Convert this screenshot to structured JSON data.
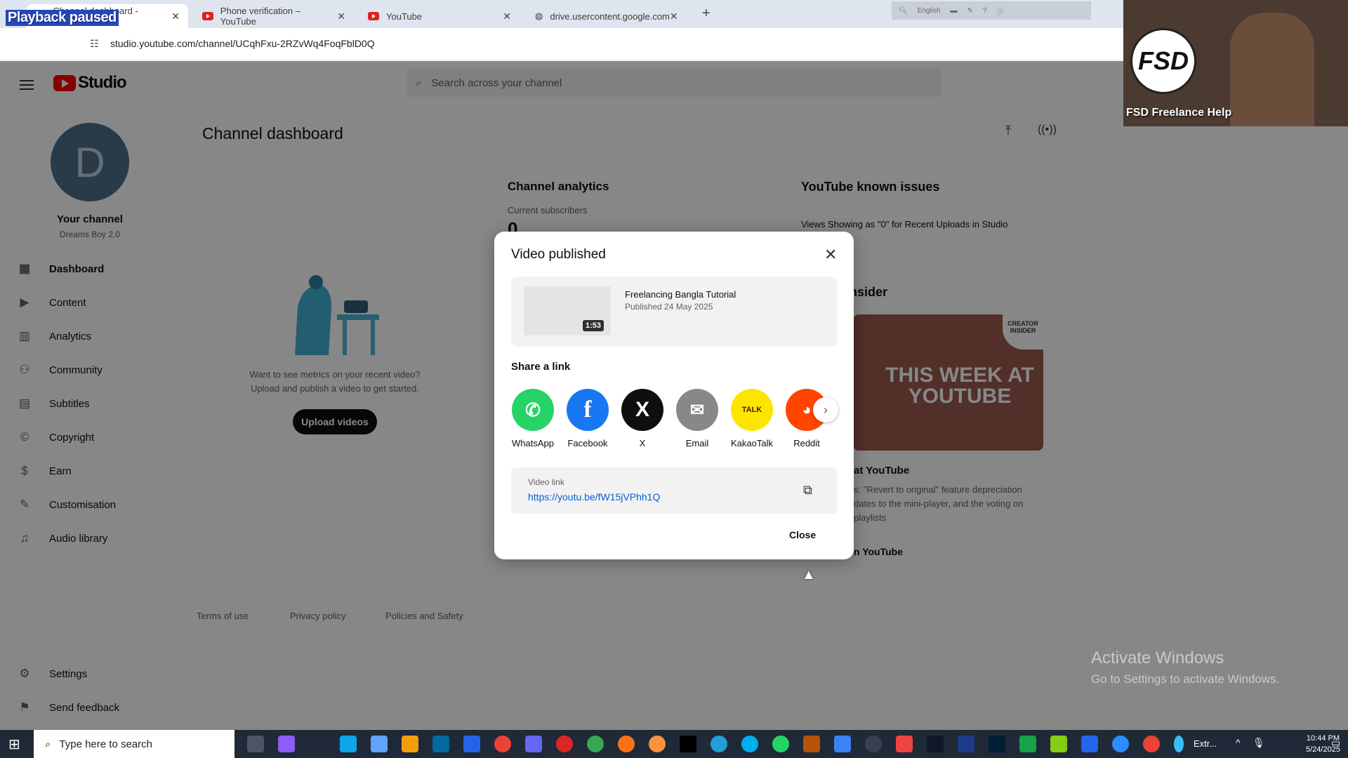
{
  "browser": {
    "playback_overlay": "Playback paused",
    "tabs": [
      {
        "label": "Channel dashboard - YouTube"
      },
      {
        "label": "Phone verification – YouTube"
      },
      {
        "label": "YouTube"
      },
      {
        "label": "drive.usercontent.google.com"
      }
    ],
    "new_tab": "+",
    "url": "studio.youtube.com/channel/UCqhFxu-2RZvWq4FoqFblD0Q",
    "language": "English"
  },
  "studio": {
    "logo_text": "Studio",
    "search_placeholder": "Search across your channel",
    "channel": {
      "avatar_letter": "D",
      "name": "Your channel",
      "handle": "Dreams Boy 2.0"
    },
    "nav": [
      {
        "label": "Dashboard",
        "icon": "dashboard-icon"
      },
      {
        "label": "Content",
        "icon": "content-icon"
      },
      {
        "label": "Analytics",
        "icon": "analytics-icon"
      },
      {
        "label": "Community",
        "icon": "community-icon"
      },
      {
        "label": "Subtitles",
        "icon": "subtitles-icon"
      },
      {
        "label": "Copyright",
        "icon": "copyright-icon"
      },
      {
        "label": "Earn",
        "icon": "earn-icon"
      },
      {
        "label": "Customisation",
        "icon": "customisation-icon"
      },
      {
        "label": "Audio library",
        "icon": "audio-library-icon"
      }
    ],
    "settings": "Settings",
    "feedback": "Send feedback",
    "dashboard_title": "Channel dashboard",
    "hint_line1": "Want to see metrics on your recent video?",
    "hint_line2": "Upload and publish a video to get started.",
    "upload_button": "Upload videos",
    "analytics": {
      "title": "Channel analytics",
      "subscribers_label": "Current subscribers",
      "subscribers_value": "0"
    },
    "known_issues": {
      "title": "YouTube known issues",
      "item": "Views Showing as \"0\" for Recent Uploads in Studio"
    },
    "insider": {
      "title_fragment": "nsider",
      "thumb_text": "THIS WEEK AT YOUTUBE",
      "badge": "CREATOR INSIDER",
      "article_title_fragment": "at YouTube",
      "article_line1": "s: \"Revert to original\" feature depreciation",
      "article_line2": "dates to the mini-player, and the voting on",
      "article_line3": "playlists",
      "link_fragment": "n YouTube"
    },
    "footer": [
      "Terms of use",
      "Privacy policy",
      "Policies and Safety"
    ]
  },
  "modal": {
    "title": "Video published",
    "video_title": "Freelancing Bangla Tutorial",
    "published": "Published 24 May 2025",
    "duration": "1:53",
    "share_heading": "Share a link",
    "share_targets": [
      {
        "label": "WhatsApp",
        "color": "#25d366"
      },
      {
        "label": "Facebook",
        "color": "#1877f2"
      },
      {
        "label": "X",
        "color": "#0f0f0f"
      },
      {
        "label": "Email",
        "color": "#888888"
      },
      {
        "label": "KakaoTalk",
        "color": "#fee500"
      },
      {
        "label": "Reddit",
        "color": "#ff4500"
      }
    ],
    "link_label": "Video link",
    "link_url": "https://youtu.be/fW15jVPhh1Q",
    "close_button": "Close"
  },
  "webcam": {
    "logo": "FSD",
    "caption": "FSD Freelance Help"
  },
  "windows": {
    "watermark_title": "Activate Windows",
    "watermark_sub": "Go to Settings to activate Windows.",
    "search_placeholder": "Type here to search",
    "time": "10:44 PM",
    "date": "5/24/2025",
    "extra": "Extr..."
  }
}
